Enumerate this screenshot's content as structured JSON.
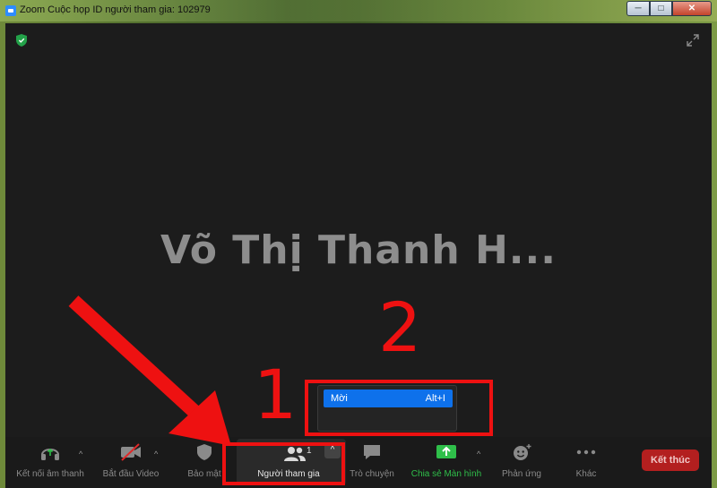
{
  "window": {
    "title": "Zoom Cuộc họp ID người tham gia: 102979",
    "buttons": {
      "minimize": "─",
      "maximize": "□",
      "close": "✕"
    }
  },
  "video": {
    "participant_name": "Võ Thị Thanh H..."
  },
  "toolbar": {
    "items": [
      {
        "label": "Kết nối âm thanh",
        "icon": "headphones-icon"
      },
      {
        "label": "Bắt đầu Video",
        "icon": "video-off-icon"
      },
      {
        "label": "Bảo mật",
        "icon": "shield-icon"
      },
      {
        "label": "Người tham gia",
        "icon": "participants-icon",
        "count": "1"
      },
      {
        "label": "Trò chuyện",
        "icon": "chat-icon"
      },
      {
        "label": "Chia sẻ Màn hình",
        "icon": "share-screen-icon",
        "color": "#2fbf4a"
      },
      {
        "label": "Phản ứng",
        "icon": "reaction-icon"
      },
      {
        "label": "Khác",
        "icon": "more-icon"
      }
    ],
    "end_button": "Kết thúc"
  },
  "popup_menu": {
    "items": [
      {
        "label": "Mời",
        "shortcut": "Alt+I"
      }
    ]
  },
  "annotations": {
    "step1": "1",
    "step2": "2",
    "color": "#ee1111"
  },
  "colors": {
    "accent": "#0e71eb",
    "end": "#b31f1f",
    "share": "#2fbf4a"
  }
}
